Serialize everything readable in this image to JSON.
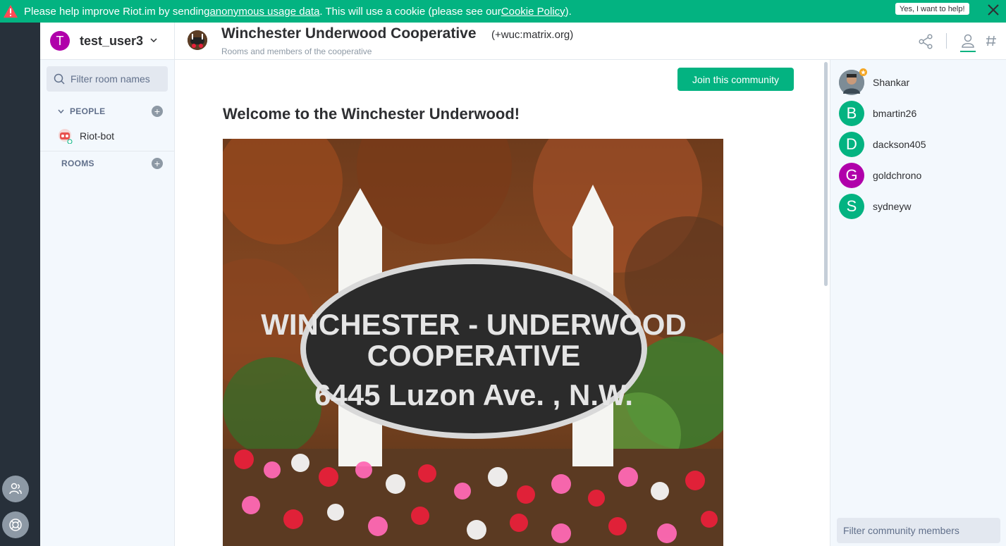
{
  "banner": {
    "text_before": "Please help improve Riot.im by sending ",
    "link1": "anonymous usage data",
    "text_middle": ". This will use a cookie (please see our ",
    "link2": "Cookie Policy",
    "text_after": ").",
    "help_button": "Yes, I want to help!",
    "color": "#03b381"
  },
  "user": {
    "initial": "T",
    "name": "test_user3",
    "avatar_color": "#b000aa"
  },
  "left_panel": {
    "filter_placeholder": "Filter room names",
    "people_label": "PEOPLE",
    "rooms_label": "ROOMS",
    "people": [
      {
        "name": "Riot-bot"
      }
    ]
  },
  "header": {
    "community_name": "Winchester Underwood Cooperative",
    "community_id": "(+wuc:matrix.org)",
    "description": "Rooms and members of the cooperative"
  },
  "main": {
    "join_button": "Join this community",
    "welcome_title": "Welcome to the Winchester Underwood!",
    "sign": {
      "line1": "WINCHESTER - UNDERWOOD",
      "line2": "COOPERATIVE",
      "line3": "6445 Luzon Ave. , N.W."
    }
  },
  "members": [
    {
      "name": "Shankar",
      "initial": "",
      "color": "#6a7b8a",
      "admin": true
    },
    {
      "name": "bmartin26",
      "initial": "B",
      "color": "#03b381",
      "admin": false
    },
    {
      "name": "dackson405",
      "initial": "D",
      "color": "#03b381",
      "admin": false
    },
    {
      "name": "goldchrono",
      "initial": "G",
      "color": "#b000aa",
      "admin": false
    },
    {
      "name": "sydneyw",
      "initial": "S",
      "color": "#03b381",
      "admin": false
    }
  ],
  "right_panel": {
    "filter_placeholder": "Filter community members"
  },
  "icons": {
    "warning": "warning-icon",
    "close": "close-icon",
    "share": "share-icon",
    "members": "person-icon",
    "rooms": "hash-icon",
    "search": "search-icon"
  }
}
